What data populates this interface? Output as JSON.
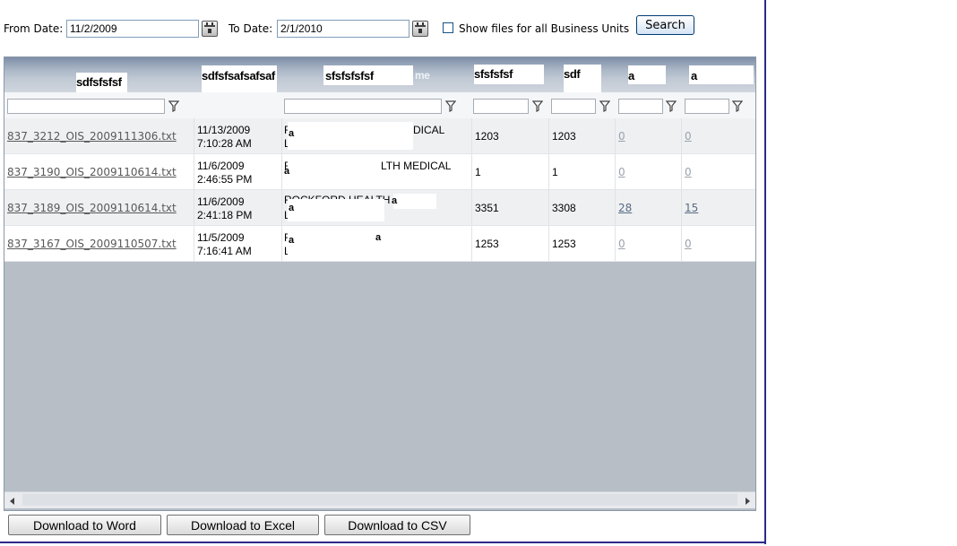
{
  "filters": {
    "from_label": "From Date:",
    "from_value": "11/2/2009",
    "to_label": "To Date:",
    "to_value": "2/1/2010",
    "checkbox_label": "Show files for all Business Units",
    "checkbox_checked": false,
    "search_label": "Search"
  },
  "grid": {
    "headers": [
      {
        "visible": "sdfsfsfsf"
      },
      {
        "visible": "sdfsfsafsafsaf"
      },
      {
        "visible": "sfsfsfsfsf",
        "partial": "me"
      },
      {
        "visible": "sfsfsfsf"
      },
      {
        "visible": "sdf"
      },
      {
        "visible": "a"
      },
      {
        "visible": "a"
      }
    ],
    "rows": [
      {
        "file": "837_3212_OIS_2009111306.txt",
        "date": "11/13/2009",
        "time": "7:10:28 AM",
        "provider_line1": "F",
        "provider_tail": "DICAL",
        "provider_line2": "L",
        "stub": "a",
        "received": "1203",
        "processed": "1203",
        "col6": "0",
        "col7": "0"
      },
      {
        "file": "837_3190_OIS_2009110614.txt",
        "date": "11/6/2009",
        "time": "2:46:55 PM",
        "provider_line1": "R",
        "provider_tail": "LTH MEDICAL",
        "provider_line2": "",
        "stub": "a",
        "received": "1",
        "processed": "1",
        "col6": "0",
        "col7": "0"
      },
      {
        "file": "837_3189_OIS_2009110614.txt",
        "date": "11/6/2009",
        "time": "2:41:18 PM",
        "provider_line1": "ROCKFORD HEALTH",
        "provider_tail": "",
        "provider_line2": "L",
        "stub": "a",
        "received": "3351",
        "processed": "3308",
        "col6": "28",
        "col7": "15"
      },
      {
        "file": "837_3167_OIS_2009110507.txt",
        "date": "11/5/2009",
        "time": "7:16:41 AM",
        "provider_line1": "F",
        "provider_tail": "",
        "provider_line2": "L",
        "stub": "a",
        "received": "1253",
        "processed": "1253",
        "col6": "0",
        "col7": "0"
      }
    ]
  },
  "downloads": {
    "word": "Download to Word",
    "excel": "Download to Excel",
    "csv": "Download to CSV"
  },
  "colors": {
    "header_grad_top": "#7d8ea7",
    "grid_background": "#b7bec6",
    "link_color": "#595959",
    "frame_color": "#2b2b8a"
  },
  "icons": [
    "calendar-icon",
    "filter-funnel-icon",
    "scroll-left-arrow-icon",
    "scroll-right-arrow-icon"
  ]
}
